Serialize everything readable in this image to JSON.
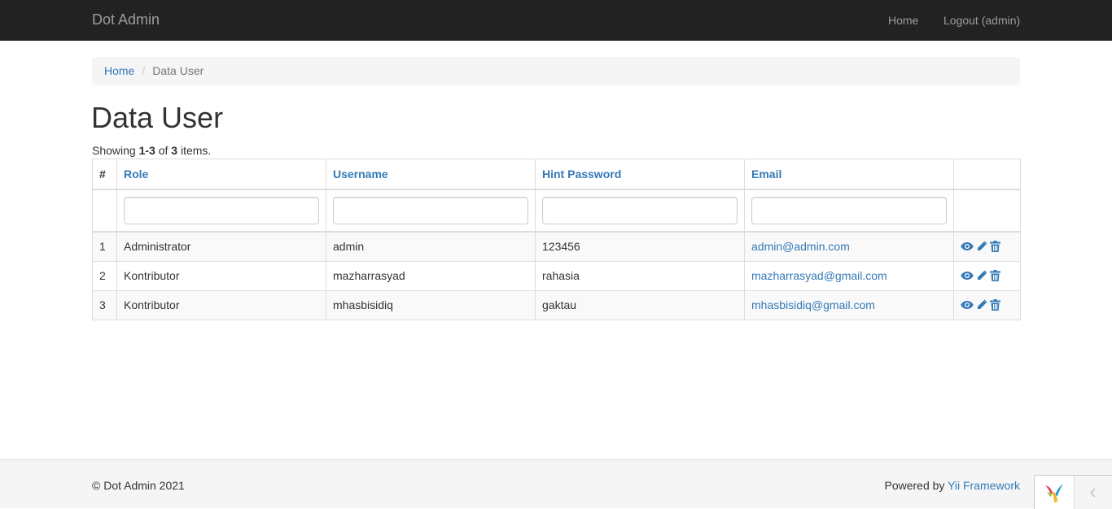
{
  "navbar": {
    "brand": "Dot Admin",
    "links": [
      "Home",
      "Logout (admin)"
    ]
  },
  "breadcrumb": {
    "home": "Home",
    "separator": "/",
    "current": "Data User"
  },
  "page": {
    "title": "Data User"
  },
  "summary": {
    "prefix": "Showing ",
    "range": "1-3",
    "of": " of ",
    "total": "3",
    "suffix": " items."
  },
  "table": {
    "headers": [
      "#",
      "Role",
      "Username",
      "Hint Password",
      "Email",
      ""
    ],
    "filters": {
      "role": "",
      "username": "",
      "hint_password": "",
      "email": ""
    },
    "rows": [
      {
        "no": "1",
        "role": "Administrator",
        "username": "admin",
        "hint_password": "123456",
        "email": "admin@admin.com"
      },
      {
        "no": "2",
        "role": "Kontributor",
        "username": "mazharrasyad",
        "hint_password": "rahasia",
        "email": "mazharrasyad@gmail.com"
      },
      {
        "no": "3",
        "role": "Kontributor",
        "username": "mhasbisidiq",
        "hint_password": "gaktau",
        "email": "mhasbisidiq@gmail.com"
      }
    ],
    "action_icons": [
      "eye-icon",
      "pencil-icon",
      "trash-icon"
    ]
  },
  "footer": {
    "copyright": "© Dot Admin 2021",
    "powered_prefix": "Powered by ",
    "powered_link": "Yii Framework"
  },
  "debug_toolbar": {
    "logo_icon": "yii-logo-icon",
    "collapse_icon": "chevron-left-icon"
  },
  "colors": {
    "navbar_bg": "#222222",
    "navbar_text": "#9d9d9d",
    "link": "#337ab7",
    "footer_bg": "#f5f5f5",
    "table_stripe": "#f9f9f9"
  }
}
